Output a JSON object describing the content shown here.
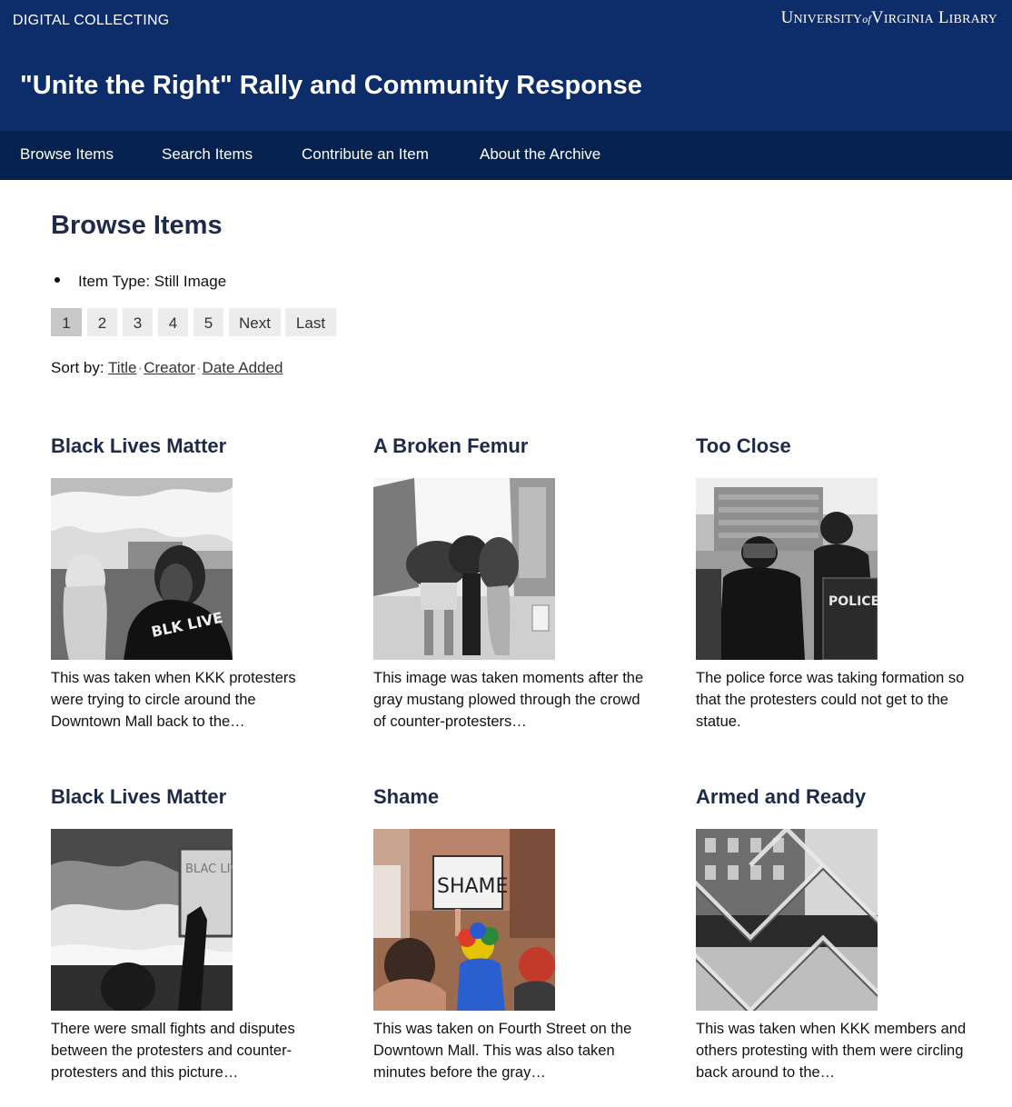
{
  "header": {
    "site_label": "DIGITAL COLLECTING",
    "logo": {
      "u": "U",
      "niversity": "NIVERSITY",
      "of": "of",
      "v": "V",
      "irginia": "IRGINIA",
      "l": "L",
      "ibrary": "IBRARY"
    },
    "site_title": "\"Unite the Right\" Rally and Community Response",
    "background_color": "#0c2d6a"
  },
  "nav": {
    "items": [
      "Browse Items",
      "Search Items",
      "Contribute an Item",
      "About the Archive"
    ],
    "background_color": "#05214f"
  },
  "main": {
    "heading": "Browse Items",
    "filter": "Item Type: Still Image",
    "pagination": [
      "1",
      "2",
      "3",
      "4",
      "5",
      "Next",
      "Last"
    ],
    "current_page": "1",
    "sort": {
      "label": "Sort by:",
      "options": [
        "Title",
        "Creator",
        "Date Added"
      ]
    },
    "items": [
      {
        "title": "Black Lives Matter",
        "description": "This was taken when KKK protesters were trying to circle around the Downtown Mall back to the…",
        "image_icon": "photo-woman-protester-icon",
        "sign_text": "BLK LIVE"
      },
      {
        "title": "A Broken Femur",
        "description": "This image was taken moments after the gray mustang plowed through the crowd of counter-protesters…",
        "image_icon": "photo-people-carrying-injured-icon",
        "sign_text": ""
      },
      {
        "title": "Too Close",
        "description": "The police force was taking formation so that the protesters could not get to the statue.",
        "image_icon": "photo-riot-police-icon",
        "sign_text": "POLICE"
      },
      {
        "title": "Black Lives Matter",
        "description": "There were small fights and disputes between the protesters and counter-protesters and this picture…",
        "image_icon": "photo-raised-sign-icon",
        "sign_text": "BLAC LIVE MA"
      },
      {
        "title": "Shame",
        "description": "This was taken on Fourth Street on the Downtown Mall. This was also taken minutes before the gray…",
        "image_icon": "photo-shame-sign-icon",
        "sign_text": "SHAME"
      },
      {
        "title": "Armed and Ready",
        "description": "This was taken when KKK members and others protesting with them were circling back around to the…",
        "image_icon": "photo-chain-fence-icon",
        "sign_text": ""
      }
    ]
  },
  "colors": {
    "heading_text": "#1e2a4a",
    "page_button": "#ececec",
    "page_button_current": "#c8c8c8"
  }
}
